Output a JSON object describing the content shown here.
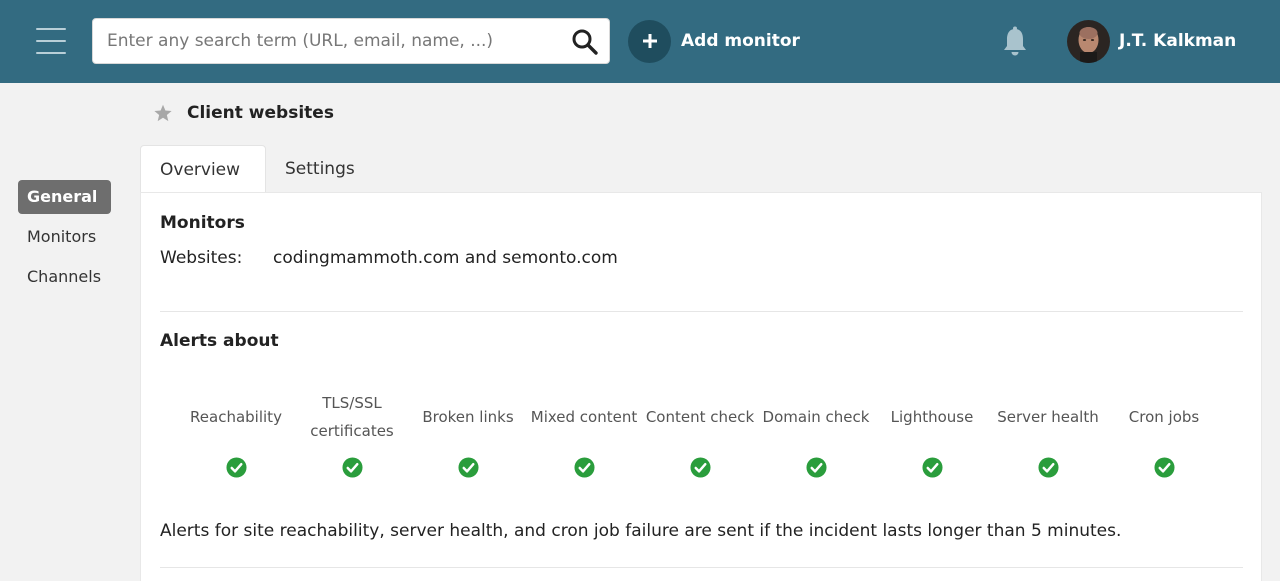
{
  "header": {
    "search_placeholder": "Enter any search term (URL, email, name, ...)",
    "add_monitor_label": "Add monitor",
    "user_name": "J.T. Kalkman"
  },
  "sidebar": {
    "items": [
      {
        "label": "General",
        "active": true
      },
      {
        "label": "Monitors",
        "active": false
      },
      {
        "label": "Channels",
        "active": false
      }
    ]
  },
  "page": {
    "title": "Client websites",
    "tabs": [
      {
        "label": "Overview",
        "active": true
      },
      {
        "label": "Settings",
        "active": false
      }
    ]
  },
  "monitors": {
    "heading": "Monitors",
    "websites_label": "Websites:",
    "websites_value": "codingmammoth.com and semonto.com"
  },
  "alerts": {
    "heading": "Alerts about",
    "items": [
      {
        "label": "Reachability",
        "enabled": true
      },
      {
        "label": "TLS/SSL certificates",
        "enabled": true
      },
      {
        "label": "Broken links",
        "enabled": true
      },
      {
        "label": "Mixed content",
        "enabled": true
      },
      {
        "label": "Content check",
        "enabled": true
      },
      {
        "label": "Domain check",
        "enabled": true
      },
      {
        "label": "Lighthouse",
        "enabled": true
      },
      {
        "label": "Server health",
        "enabled": true
      },
      {
        "label": "Cron jobs",
        "enabled": true
      }
    ],
    "note": "Alerts for site reachability, server health, and cron job failure are sent if the incident lasts longer than 5 minutes."
  },
  "colors": {
    "topbar": "#336b81",
    "check_green": "#2a9d3c",
    "active_sidebar": "#6e6e6e"
  }
}
